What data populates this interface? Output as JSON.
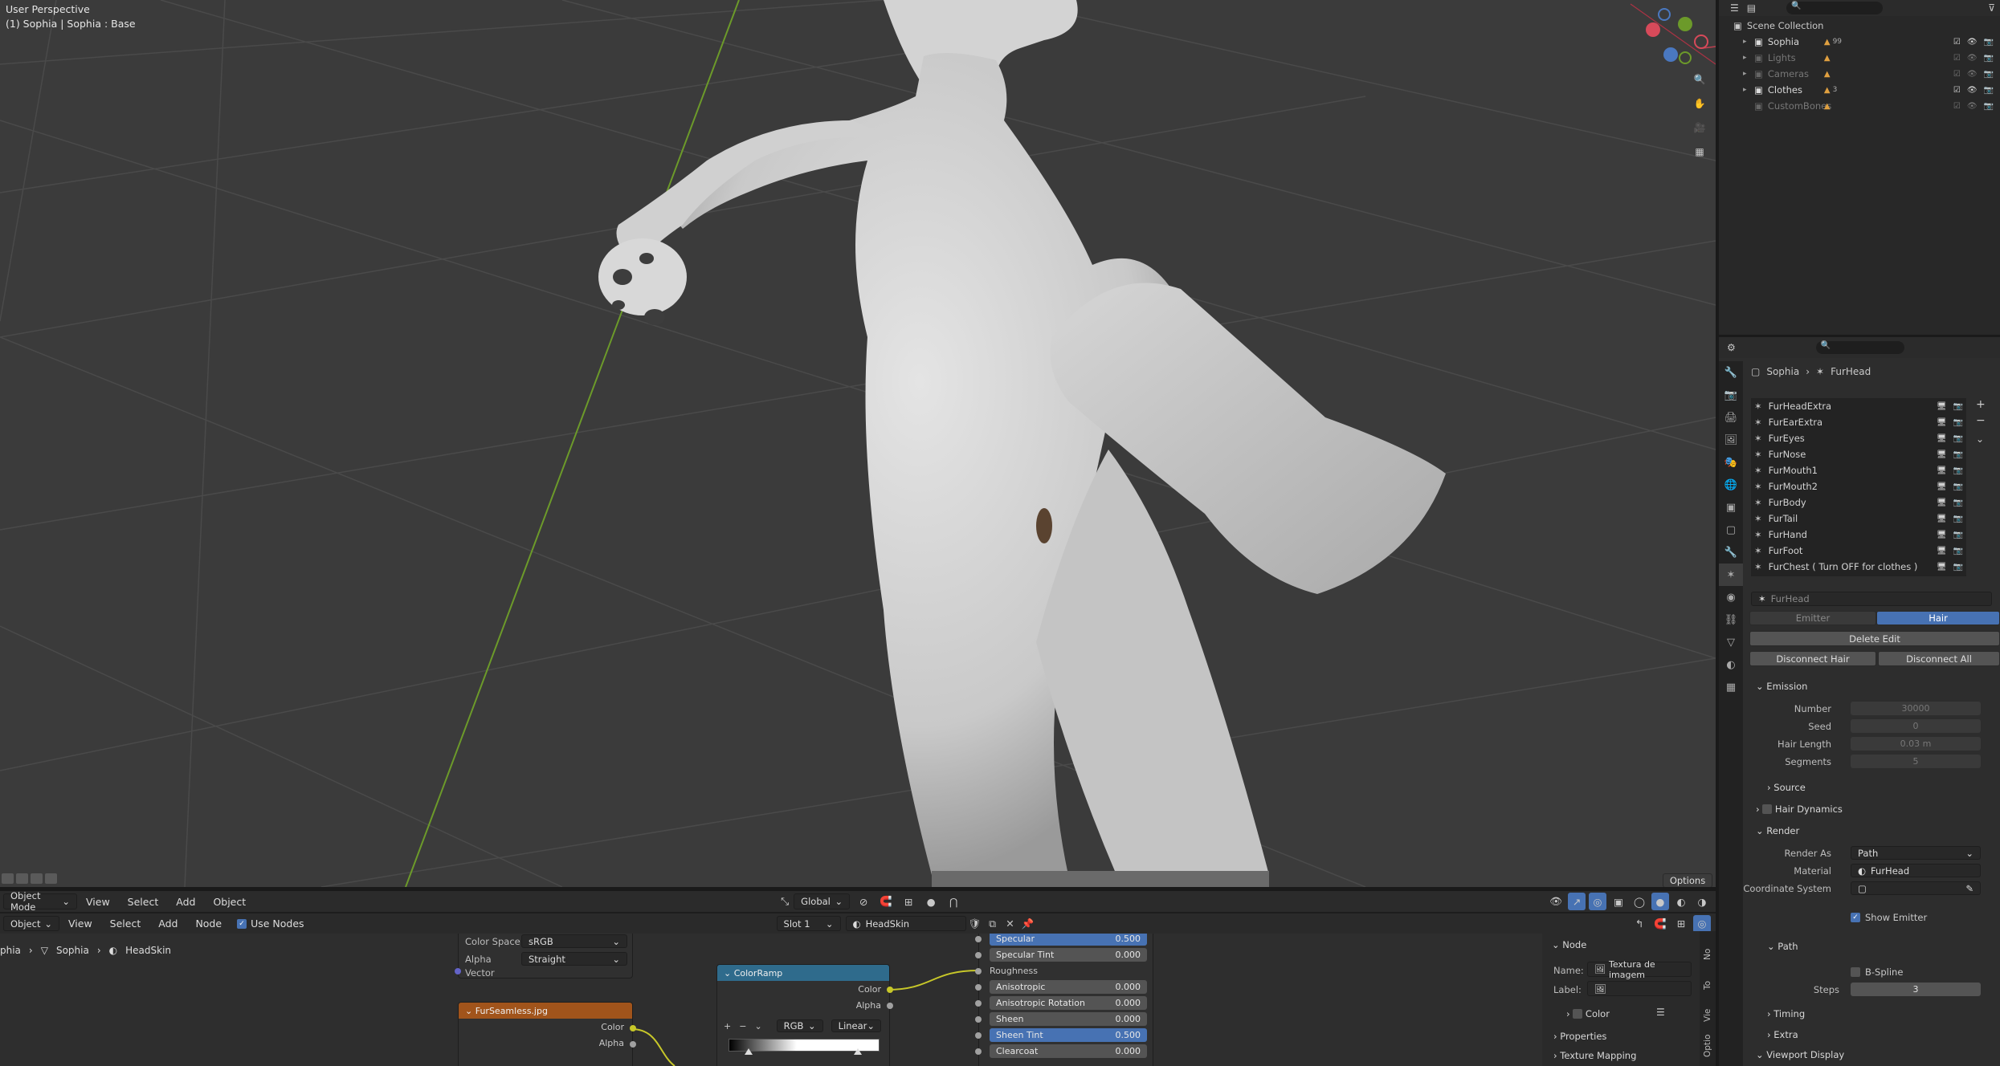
{
  "viewport": {
    "perspective_label": "User Perspective",
    "object_label": "(1) Sophia | Sophia : Base",
    "options_label": "Options"
  },
  "vp_header": {
    "mode": "Object Mode",
    "menus": [
      "View",
      "Select",
      "Add",
      "Object"
    ],
    "transform": "Global"
  },
  "node_header": {
    "type": "Object",
    "menus": [
      "View",
      "Select",
      "Add",
      "Node"
    ],
    "use_nodes_label": "Use Nodes",
    "use_nodes": true,
    "slot": "Slot 1",
    "material": "HeadSkin"
  },
  "node_breadcrumb": [
    "phia",
    "Sophia",
    "HeadSkin"
  ],
  "nodes": {
    "image_texture_top": {
      "color_space_label": "Color Space",
      "color_space": "sRGB",
      "alpha_label": "Alpha",
      "alpha": "Straight",
      "vector_label": "Vector"
    },
    "fur_image": {
      "title": "FurSeamless.jpg",
      "color_out": "Color",
      "alpha_out": "Alpha"
    },
    "color_ramp": {
      "title": "ColorRamp",
      "color_out": "Color",
      "alpha_out": "Alpha",
      "mode": "RGB",
      "interp": "Linear"
    },
    "bsdf": [
      {
        "label": "Specular",
        "value": "0.500",
        "highlight": true
      },
      {
        "label": "Specular Tint",
        "value": "0.000",
        "highlight": false
      },
      {
        "label": "Roughness",
        "value": "",
        "highlight": false
      },
      {
        "label": "Anisotropic",
        "value": "0.000",
        "highlight": false
      },
      {
        "label": "Anisotropic Rotation",
        "value": "0.000",
        "highlight": false
      },
      {
        "label": "Sheen",
        "value": "0.000",
        "highlight": false
      },
      {
        "label": "Sheen Tint",
        "value": "0.500",
        "highlight": true
      },
      {
        "label": "Clearcoat",
        "value": "0.000",
        "highlight": false
      }
    ]
  },
  "node_sidebar": {
    "section": "Node",
    "name_label": "Name:",
    "name_value": "Textura de imagem",
    "label_label": "Label:",
    "color_label": "Color",
    "properties_label": "Properties",
    "texture_mapping_label": "Texture Mapping",
    "tabs": [
      "No",
      "To",
      "Vie",
      "Optio"
    ]
  },
  "outliner": {
    "root": "Scene Collection",
    "items": [
      {
        "label": "Sophia",
        "badge": "99",
        "dim": false
      },
      {
        "label": "Lights",
        "badge": "",
        "dim": true
      },
      {
        "label": "Cameras",
        "badge": "",
        "dim": true
      },
      {
        "label": "Clothes",
        "badge": "3",
        "dim": false
      },
      {
        "label": "CustomBones",
        "badge": "",
        "dim": true
      }
    ]
  },
  "properties": {
    "breadcrumb_object": "Sophia",
    "breadcrumb_system": "FurHead",
    "particle_systems": [
      "FurHeadExtra",
      "FurEarExtra",
      "FurEyes",
      "FurNose",
      "FurMouth1",
      "FurMouth2",
      "FurBody",
      "FurTail",
      "FurHand",
      "FurFoot",
      "FurChest ( Turn OFF for clothes )"
    ],
    "settings_name": "FurHead",
    "emitter_tab": "Emitter",
    "hair_tab": "Hair",
    "delete_edit": "Delete Edit",
    "disconnect_hair": "Disconnect Hair",
    "disconnect_all": "Disconnect All",
    "emission": {
      "title": "Emission",
      "number_label": "Number",
      "number": "30000",
      "seed_label": "Seed",
      "seed": "0",
      "hair_length_label": "Hair Length",
      "hair_length": "0.03 m",
      "segments_label": "Segments",
      "segments": "5"
    },
    "source_label": "Source",
    "hair_dynamics_label": "Hair Dynamics",
    "render": {
      "title": "Render",
      "render_as_label": "Render As",
      "render_as": "Path",
      "material_label": "Material",
      "material": "FurHead",
      "coord_label": "Coordinate System",
      "show_emitter": "Show Emitter"
    },
    "path": {
      "title": "Path",
      "bspline": "B-Spline",
      "steps_label": "Steps",
      "steps": "3"
    },
    "timing_label": "Timing",
    "extra_label": "Extra",
    "viewport_display_label": "Viewport Display"
  }
}
